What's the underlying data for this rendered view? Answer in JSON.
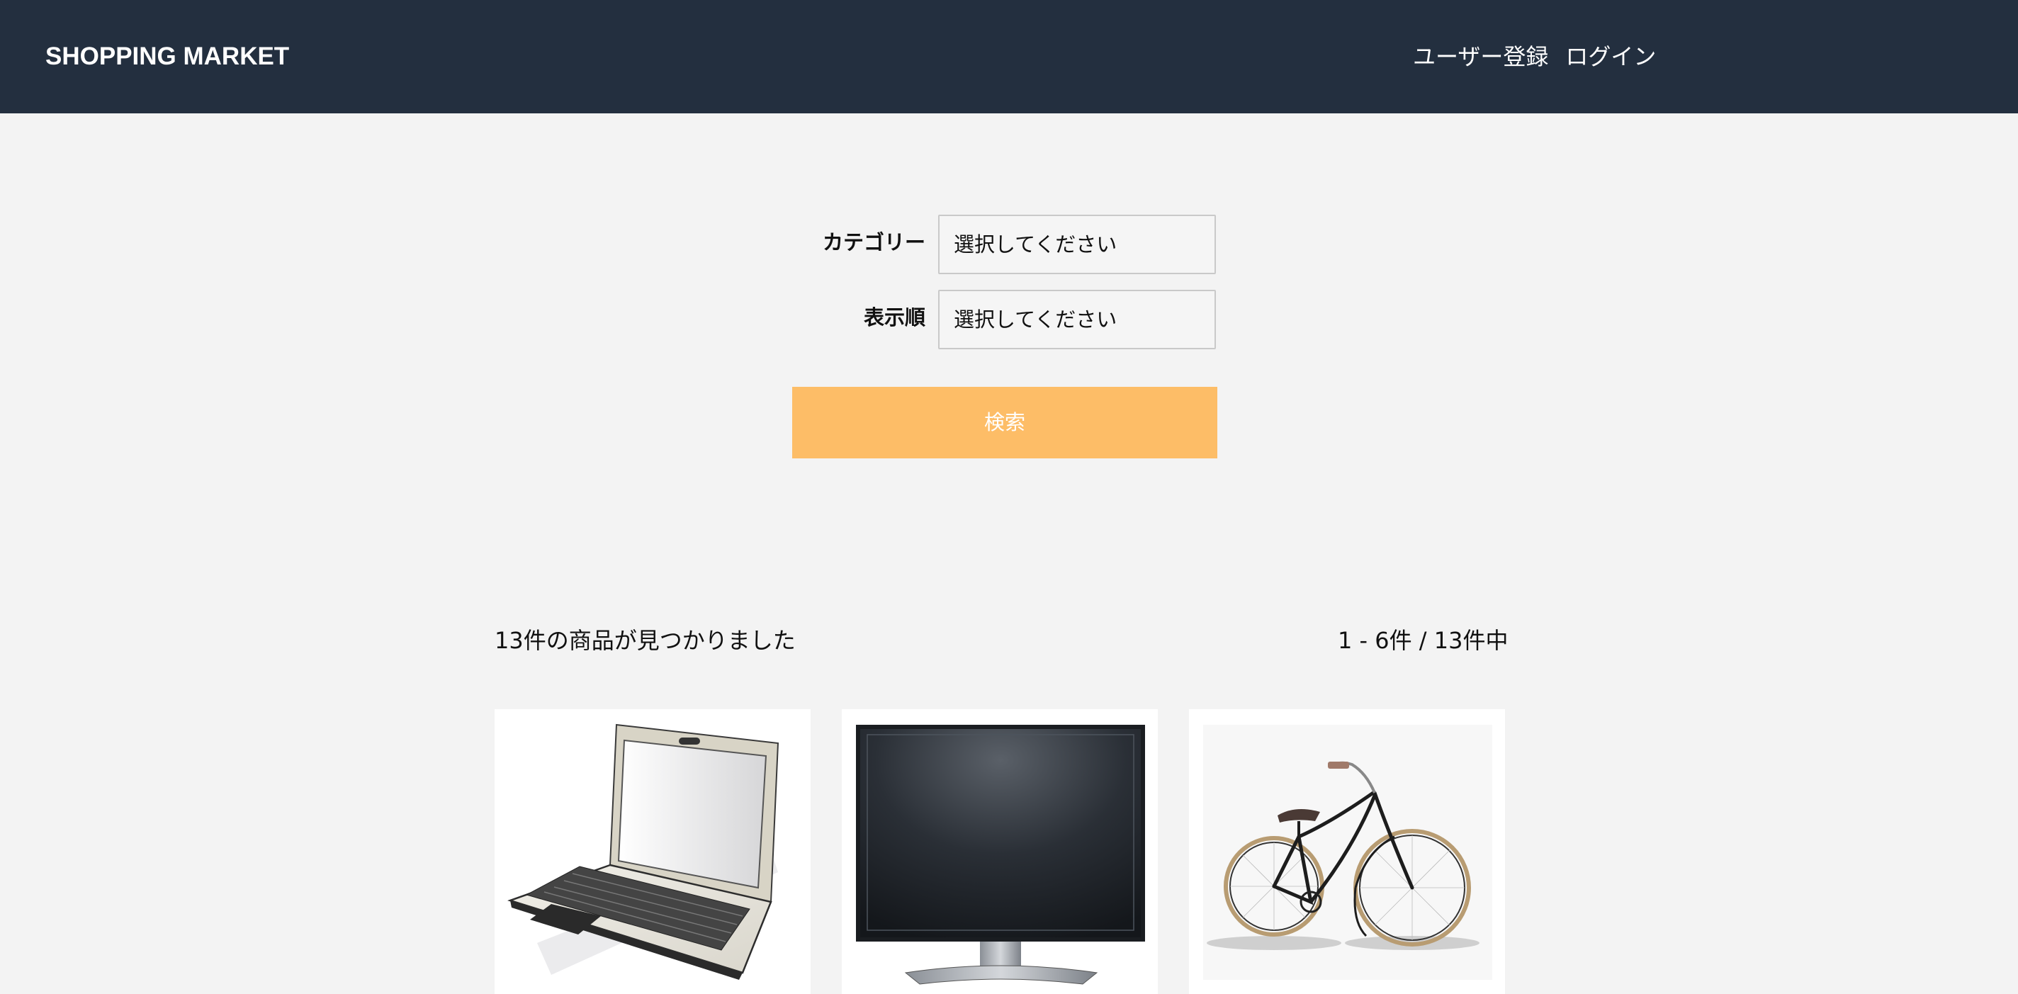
{
  "header": {
    "brand": "SHOPPING MARKET",
    "nav": {
      "register_label": "ユーザー登録",
      "login_label": "ログイン"
    }
  },
  "search_form": {
    "category_label": "カテゴリー",
    "category_value": "選択してください",
    "sort_label": "表示順",
    "sort_value": "選択してください",
    "search_button_label": "検索"
  },
  "results": {
    "count_text": "13件の商品が見つかりました",
    "range_text": "1 - 6件 / 13件中"
  },
  "products": [
    {
      "image": "laptop-image"
    },
    {
      "image": "monitor-image"
    },
    {
      "image": "bicycle-image"
    }
  ],
  "colors": {
    "header_bg": "#232f3f",
    "page_bg": "#f3f3f3",
    "accent_button": "#fdbd67"
  }
}
